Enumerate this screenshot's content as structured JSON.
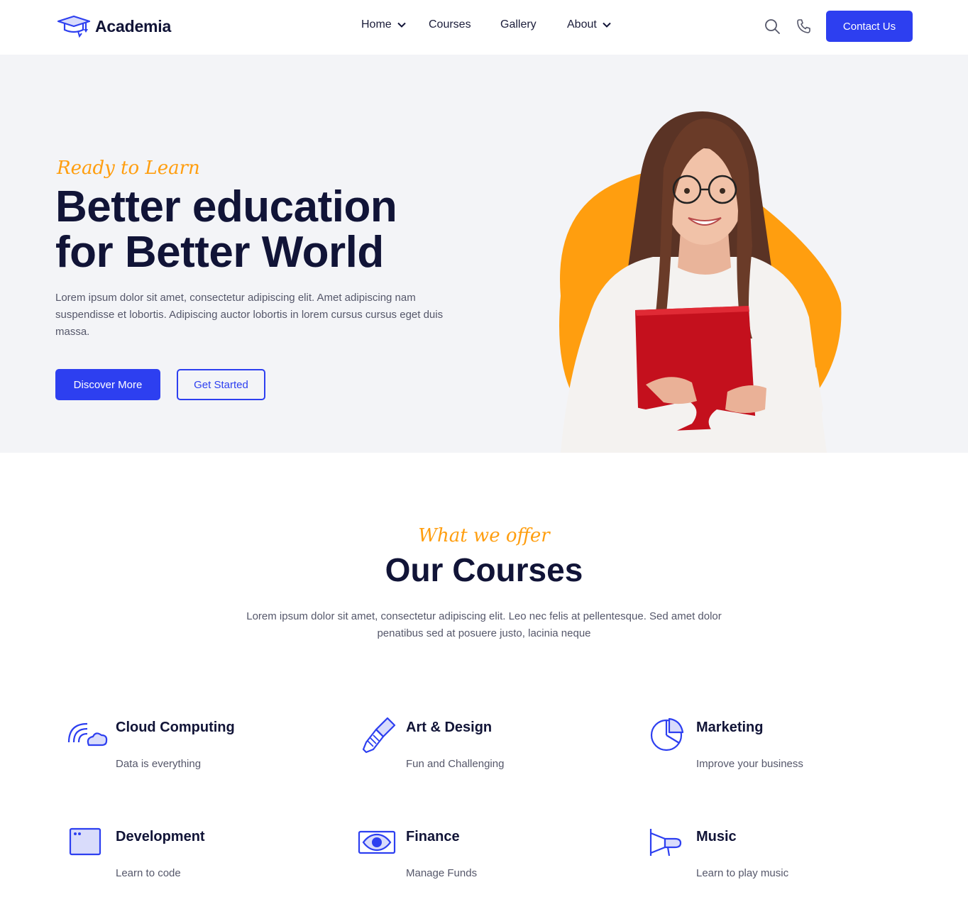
{
  "brand": {
    "name": "Academia",
    "accent": "#2d3ff0",
    "highlight": "#ff9e0f",
    "dark": "#111437"
  },
  "nav": {
    "items": [
      {
        "label": "Home",
        "has_dropdown": true
      },
      {
        "label": "Courses",
        "has_dropdown": false
      },
      {
        "label": "Gallery",
        "has_dropdown": false
      },
      {
        "label": "About",
        "has_dropdown": true
      }
    ],
    "icons": [
      "search-icon",
      "phone-icon"
    ],
    "contact_label": "Contact Us"
  },
  "hero": {
    "tagline": "Ready to Learn",
    "title_line1": "Better education",
    "title_line2": "for Better World",
    "description": "Lorem ipsum dolor sit amet, consectetur adipiscing elit. Amet adipiscing nam suspendisse et lobortis. Adipiscing auctor lobortis in lorem cursus cursus eget duis massa.",
    "primary_button": "Discover More",
    "secondary_button": "Get Started"
  },
  "courses_section": {
    "tagline": "What we offer",
    "title": "Our Courses",
    "description": "Lorem ipsum dolor sit amet, consectetur adipiscing elit. Leo nec felis at pellentesque. Sed amet dolor penatibus sed at posuere justo, lacinia neque",
    "items": [
      {
        "title": "Cloud Computing",
        "subtitle": "Data is everything",
        "icon": "cloud-signal-icon"
      },
      {
        "title": "Art & Design",
        "subtitle": "Fun and Challenging",
        "icon": "paint-brush-icon"
      },
      {
        "title": "Marketing",
        "subtitle": "Improve your business",
        "icon": "pie-chart-icon"
      },
      {
        "title": "Development",
        "subtitle": "Learn to code",
        "icon": "browser-window-icon"
      },
      {
        "title": "Finance",
        "subtitle": "Manage Funds",
        "icon": "banknote-icon"
      },
      {
        "title": "Music",
        "subtitle": "Learn to play music",
        "icon": "megaphone-icon"
      }
    ]
  }
}
